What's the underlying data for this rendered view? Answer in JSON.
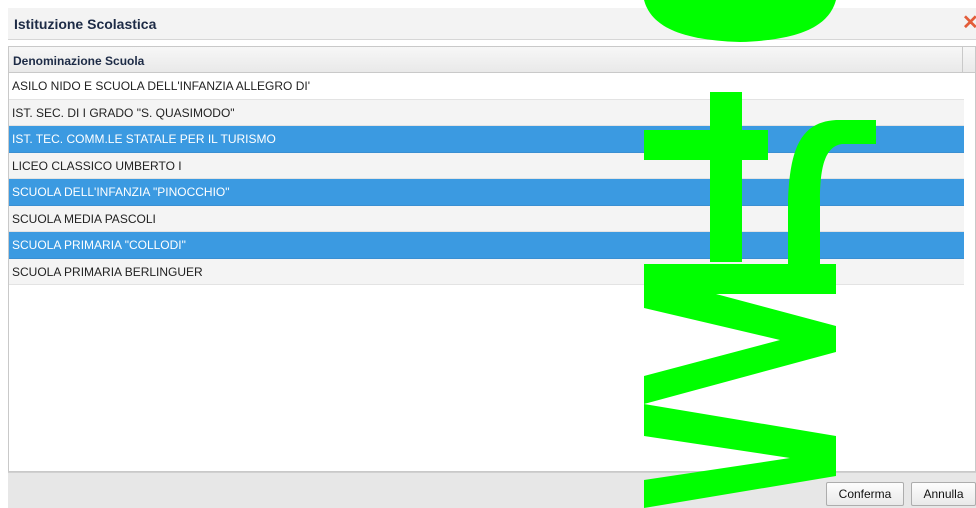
{
  "dialog": {
    "title": "Istituzione Scolastica",
    "close_icon": "close-icon"
  },
  "grid": {
    "column_header": "Denominazione Scuola",
    "rows": [
      {
        "name": "ASILO NIDO E SCUOLA DELL'INFANZIA ALLEGRO DI'",
        "selected": false
      },
      {
        "name": "IST. SEC. DI I GRADO \"S. QUASIMODO\"",
        "selected": false
      },
      {
        "name": "IST. TEC. COMM.LE STATALE PER IL TURISMO",
        "selected": true
      },
      {
        "name": "LICEO CLASSICO UMBERTO I",
        "selected": false
      },
      {
        "name": "SCUOLA DELL'INFANZIA \"PINOCCHIO\"",
        "selected": true
      },
      {
        "name": "SCUOLA MEDIA PASCOLI",
        "selected": false
      },
      {
        "name": "SCUOLA PRIMARIA \"COLLODI\"",
        "selected": true
      },
      {
        "name": "SCUOLA PRIMARIA BERLINGUER",
        "selected": false
      }
    ]
  },
  "footer": {
    "confirm_label": "Conferma",
    "cancel_label": "Annulla"
  },
  "colors": {
    "selection": "#3b9ae1",
    "close": "#e35d3a",
    "watermark": "#00ff00"
  }
}
